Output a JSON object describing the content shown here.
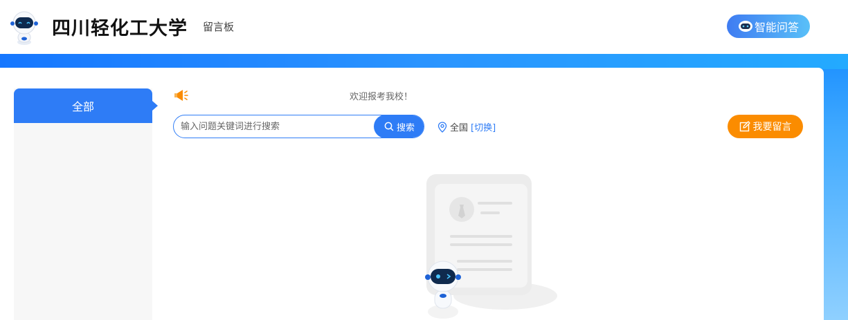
{
  "header": {
    "site_title": "四川轻化工大学",
    "sub_title": "留言板",
    "ai_button_label": "智能问答",
    "logo_icon": "robot-mascot-icon"
  },
  "sidebar": {
    "items": [
      {
        "label": "全部",
        "active": true
      }
    ]
  },
  "notice": {
    "icon": "megaphone-icon",
    "text": "欢迎报考我校！"
  },
  "search": {
    "placeholder": "输入问题关键词进行搜索",
    "value": "",
    "button_label": "搜索"
  },
  "region": {
    "icon": "location-pin-icon",
    "current": "全国",
    "switch_label": "[切换]"
  },
  "actions": {
    "leave_message_label": "我要留言"
  },
  "colors": {
    "primary": "#2e7cf6",
    "accent_orange": "#fb8c00",
    "banner_blue": "#1b8fff"
  }
}
